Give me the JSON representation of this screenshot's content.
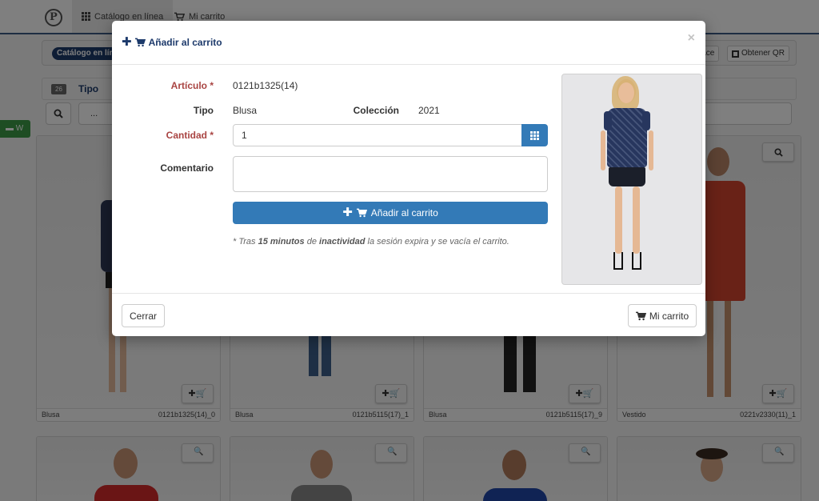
{
  "navbar": {
    "tabs": [
      {
        "label": "Catálogo en línea",
        "icon": "grid-icon",
        "active": true
      },
      {
        "label": "Mi carrito",
        "icon": "cart-icon",
        "active": false
      }
    ]
  },
  "toolbar": {
    "catalog_pill": "Catálogo en lín",
    "share_link_label": "lace",
    "get_qr_label": "Obtener QR"
  },
  "filter": {
    "count_badge": "26",
    "label": "Tipo",
    "search_placeholder": "..."
  },
  "side_tab": {
    "label": "W",
    "icon": "comment-icon"
  },
  "cards": [
    {
      "type": "Blusa",
      "code": "0121b1325(14)_0"
    },
    {
      "type": "Blusa",
      "code": "0121b5115(17)_1"
    },
    {
      "type": "Blusa",
      "code": "0121b5115(17)_9"
    },
    {
      "type": "Vestido",
      "code": "0221v2330(11)_1"
    }
  ],
  "modal": {
    "title": "Añadir al carrito",
    "close": "×",
    "fields": {
      "articulo_label": "Artículo *",
      "articulo_value": "0121b1325(14)",
      "tipo_label": "Tipo",
      "tipo_value": "Blusa",
      "coleccion_label": "Colección",
      "coleccion_value": "2021",
      "cantidad_label": "Cantidad *",
      "cantidad_value": "1",
      "comentario_label": "Comentario",
      "comentario_value": ""
    },
    "add_button": "Añadir al carrito",
    "note": {
      "prefix": "* Tras ",
      "minutes": "15 minutos",
      "mid": " de ",
      "inactivity": "inactividad",
      "suffix": " la sesión expira y se vacía el carrito."
    },
    "footer": {
      "close_button": "Cerrar",
      "cart_button": "Mi carrito"
    }
  },
  "colors": {
    "primary": "#337ab7",
    "brand_navy": "#1d3a6b",
    "required_label": "#a94442",
    "side_tab": "#3d9b46"
  }
}
